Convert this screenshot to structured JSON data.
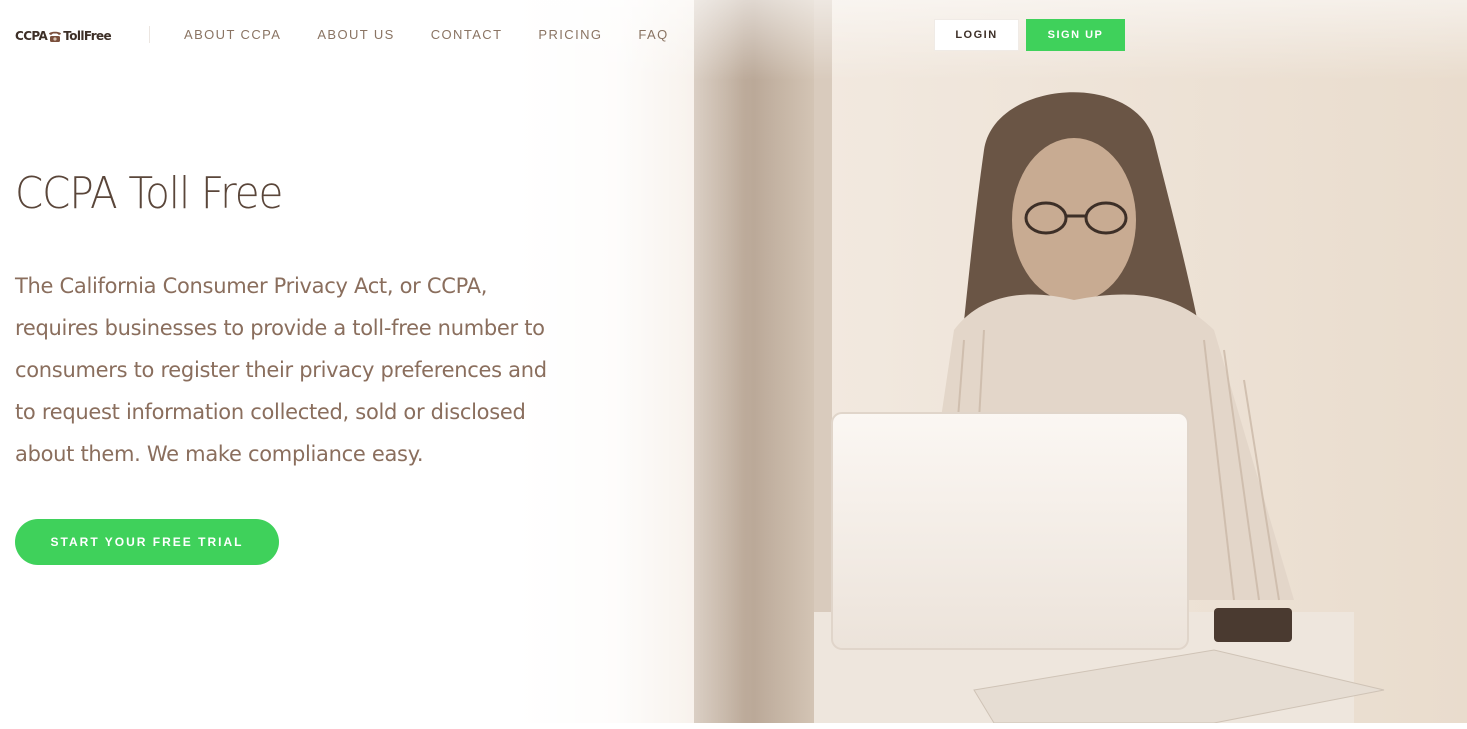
{
  "brand": {
    "logo_left": "CCPA",
    "logo_right": "TollFree"
  },
  "nav": {
    "items": [
      "ABOUT CCPA",
      "ABOUT US",
      "CONTACT",
      "PRICING",
      "FAQ"
    ]
  },
  "auth": {
    "login_label": "LOGIN",
    "signup_label": "SIGN UP"
  },
  "hero": {
    "title": "CCPA Toll Free",
    "description_lines": [
      "The California Consumer Privacy Act, or CCPA,",
      "requires businesses to provide a toll-free number to",
      "consumers to register their privacy preferences and",
      "to request information collected, sold or disclosed",
      "about them. We make compliance easy."
    ],
    "cta_label": "START YOUR FREE TRIAL",
    "photo_icon": "woman-with-laptop-photo"
  },
  "colors": {
    "accent_green": "#3fd15b",
    "text_brown": "#8a6e5d",
    "title_brown": "#5a463a"
  }
}
